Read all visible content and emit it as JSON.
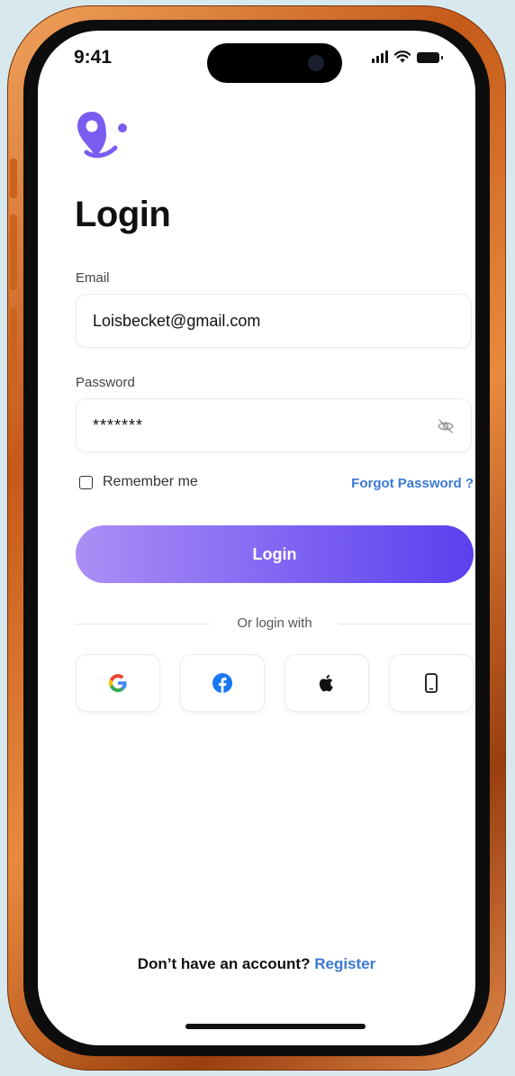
{
  "status_bar": {
    "time": "9:41"
  },
  "login": {
    "title": "Login",
    "email_label": "Email",
    "email_value": "Loisbecket@gmail.com",
    "password_label": "Password",
    "password_value": "*******",
    "remember_label": "Remember me",
    "remember_checked": false,
    "forgot_label": "Forgot Password ?",
    "submit_label": "Login",
    "divider_text": "Or login with",
    "social": [
      {
        "icon": "google-icon"
      },
      {
        "icon": "facebook-icon"
      },
      {
        "icon": "apple-icon"
      },
      {
        "icon": "phone-icon"
      }
    ],
    "footer_text": "Don’t have an account?",
    "register_label": "Register"
  },
  "colors": {
    "accent_start": "#ab8ff5",
    "accent_end": "#5d3fee",
    "link": "#3b79d4",
    "logo": "#7b5cf0"
  }
}
